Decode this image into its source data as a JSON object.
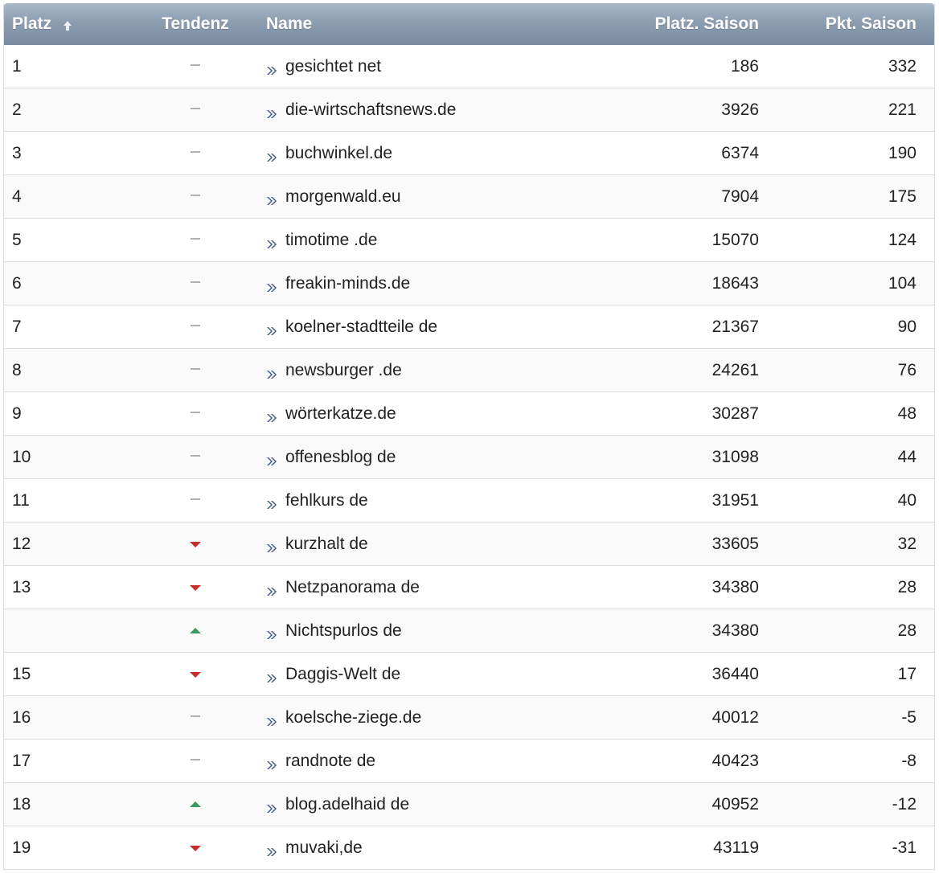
{
  "colors": {
    "header_bg": "#8c9db0",
    "header_text": "#ffffff",
    "trend_down": "#c62d2d",
    "trend_up": "#3a9a5c",
    "trend_same": "#b0b0b0",
    "link_arrow": "#3c5a80"
  },
  "header": {
    "platz": "Platz",
    "tendenz": "Tendenz",
    "name": "Name",
    "platz_saison": "Platz. Saison",
    "pkt_saison": "Pkt. Saison",
    "sort_icon": "sort-ascending-icon"
  },
  "rows": [
    {
      "platz": "1",
      "tendenz": "same",
      "name": "gesichtet net",
      "platz_saison": "186",
      "pkt_saison": "332"
    },
    {
      "platz": "2",
      "tendenz": "same",
      "name": "die-wirtschaftsnews.de",
      "platz_saison": "3926",
      "pkt_saison": "221"
    },
    {
      "platz": "3",
      "tendenz": "same",
      "name": "buchwinkel.de",
      "platz_saison": "6374",
      "pkt_saison": "190"
    },
    {
      "platz": "4",
      "tendenz": "same",
      "name": "morgenwald.eu",
      "platz_saison": "7904",
      "pkt_saison": "175"
    },
    {
      "platz": "5",
      "tendenz": "same",
      "name": "timotime .de",
      "platz_saison": "15070",
      "pkt_saison": "124"
    },
    {
      "platz": "6",
      "tendenz": "same",
      "name": "freakin-minds.de",
      "platz_saison": "18643",
      "pkt_saison": "104"
    },
    {
      "platz": "7",
      "tendenz": "same",
      "name": "koelner-stadtteile de",
      "platz_saison": "21367",
      "pkt_saison": "90"
    },
    {
      "platz": "8",
      "tendenz": "same",
      "name": "newsburger .de",
      "platz_saison": "24261",
      "pkt_saison": "76"
    },
    {
      "platz": "9",
      "tendenz": "same",
      "name": "wörterkatze.de",
      "platz_saison": "30287",
      "pkt_saison": "48"
    },
    {
      "platz": "10",
      "tendenz": "same",
      "name": "offenesblog de",
      "platz_saison": "31098",
      "pkt_saison": "44"
    },
    {
      "platz": "11",
      "tendenz": "same",
      "name": "fehlkurs de",
      "platz_saison": "31951",
      "pkt_saison": "40"
    },
    {
      "platz": "12",
      "tendenz": "down",
      "name": "kurzhalt de",
      "platz_saison": "33605",
      "pkt_saison": "32"
    },
    {
      "platz": "13",
      "tendenz": "down",
      "name": "Netzpanorama de",
      "platz_saison": "34380",
      "pkt_saison": "28"
    },
    {
      "platz": "",
      "tendenz": "up",
      "name": "Nichtspurlos de",
      "platz_saison": "34380",
      "pkt_saison": "28"
    },
    {
      "platz": "15",
      "tendenz": "down",
      "name": "Daggis-Welt de",
      "platz_saison": "36440",
      "pkt_saison": "17"
    },
    {
      "platz": "16",
      "tendenz": "same",
      "name": "koelsche-ziege.de",
      "platz_saison": "40012",
      "pkt_saison": "-5"
    },
    {
      "platz": "17",
      "tendenz": "same",
      "name": "randnote de",
      "platz_saison": "40423",
      "pkt_saison": "-8"
    },
    {
      "platz": "18",
      "tendenz": "up",
      "name": "blog.adelhaid de",
      "platz_saison": "40952",
      "pkt_saison": "-12"
    },
    {
      "platz": "19",
      "tendenz": "down",
      "name": "muvaki,de",
      "platz_saison": "43119",
      "pkt_saison": "-31"
    }
  ]
}
